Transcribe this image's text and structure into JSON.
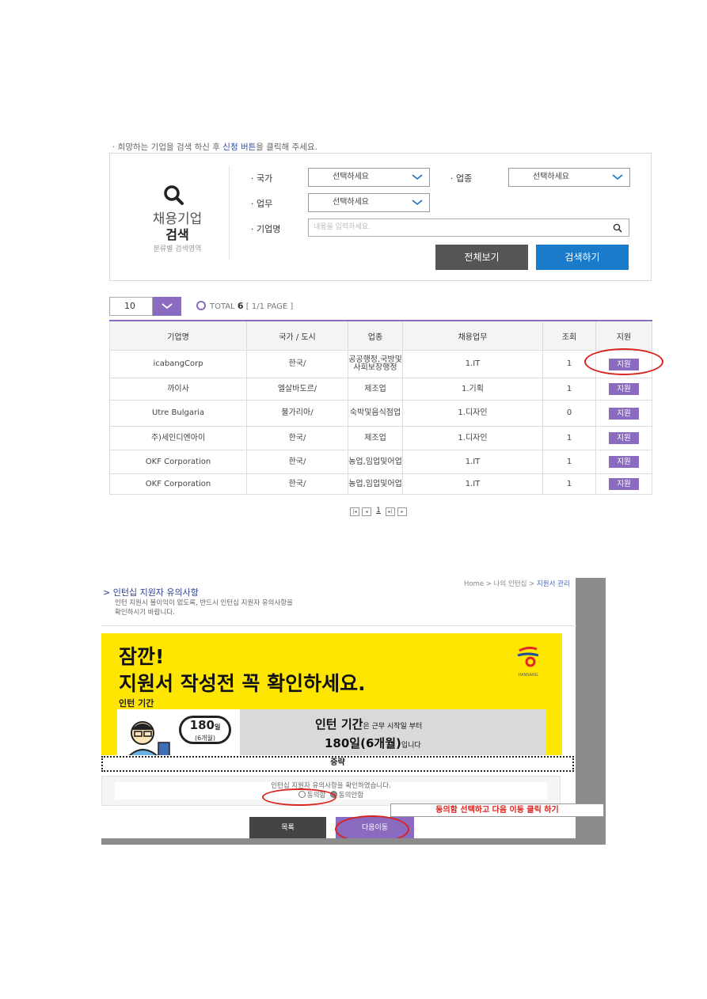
{
  "intro": {
    "before": "· 희망하는 기업을 검색 하신 후 ",
    "highlight": "신청 버튼",
    "after": "을 클릭해 주세요."
  },
  "search": {
    "title": "채용기업",
    "title2": "검색",
    "subtitle": "분류별 검색영역",
    "country_label": "· 국가",
    "country_value": "선택하세요",
    "industry_label": "· 업종",
    "industry_value": "선택하세요",
    "job_label": "· 업무",
    "job_value": "선택하세요",
    "company_label": "· 기업명",
    "company_placeholder": "내용을 입력하세요.",
    "view_all": "전체보기",
    "search_button": "검색하기"
  },
  "list": {
    "page_size": "10",
    "total_label": "TOTAL",
    "total_count": "6",
    "page_info": "[ 1/1 PAGE ]",
    "headers": [
      "기업명",
      "국가 / 도시",
      "업종",
      "채용업무",
      "조회",
      "지원"
    ],
    "rows": [
      {
        "company": "icabangCorp",
        "country": "한국/",
        "industry": "공공행정,국방및사회보장행정",
        "job": "1.IT",
        "views": "1",
        "apply": "지원"
      },
      {
        "company": "까이사",
        "country": "엘살바도르/",
        "industry": "제조업",
        "job": "1.기획",
        "views": "1",
        "apply": "지원"
      },
      {
        "company": "Utre Bulgaria",
        "country": "불가리아/",
        "industry": "숙박및음식점업",
        "job": "1.디자인",
        "views": "0",
        "apply": "지원"
      },
      {
        "company": "주)세인디엔아이",
        "country": "한국/",
        "industry": "제조업",
        "job": "1.디자인",
        "views": "1",
        "apply": "지원"
      },
      {
        "company": "OKF Corporation",
        "country": "한국/",
        "industry": "농업,임업및어업",
        "job": "1.IT",
        "views": "1",
        "apply": "지원"
      },
      {
        "company": "OKF Corporation",
        "country": "한국/",
        "industry": "농업,임업및어업",
        "job": "1.IT",
        "views": "1",
        "apply": "지원"
      }
    ],
    "pager": {
      "current": "1"
    }
  },
  "notice": {
    "breadcrumb_home": "Home > 나의 인턴십 > ",
    "breadcrumb_current": "지원서 관리",
    "title": "> 인턴십 지원자 유의사항",
    "desc_line1": "인턴 지원시 불이익이 없도록, 반드시 인턴십 지원자 유의사항을",
    "desc_line2": "확인하시기 바랍니다.",
    "banner_line1": "잠깐!",
    "banner_line2": "지원서 작성전 꼭 확인하세요.",
    "banner_section": "인턴 기간",
    "logo_text": "HANSANG",
    "bubble_days": "180",
    "bubble_unit": "일",
    "bubble_months": "(6개월)",
    "period_title": "인턴 기간",
    "period_title_suffix": "은 근무 시작일 부터",
    "period_days": "180일(6개월)",
    "period_suffix": "입니다",
    "omitted": "중략",
    "confirm_text": "인턴십 지원자 유의사항을 확인하였습니다.",
    "agree": "동의함",
    "disagree": "동의안함",
    "instruction": "동의함 선택하고 다음 이동 클릭 하기",
    "list_button": "목록",
    "next_button": "다음이동"
  },
  "colors": {
    "accent_purple": "#8a6bbf",
    "search_blue": "#1a7bcb",
    "annotation_red": "#d9231d",
    "banner_yellow": "#ffe600"
  }
}
